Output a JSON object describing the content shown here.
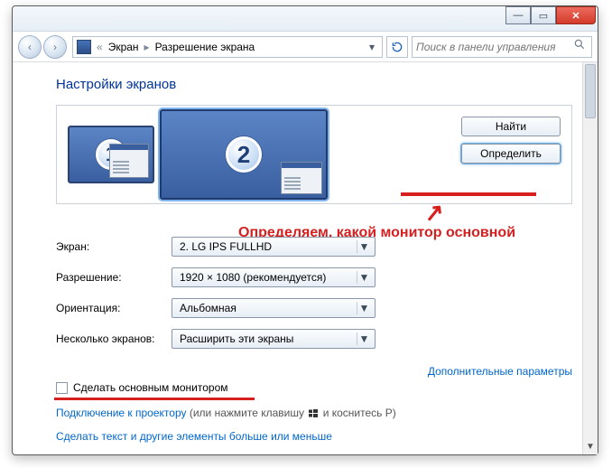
{
  "titlebar": {
    "min": "—",
    "max": "▭",
    "close": "✕"
  },
  "address": {
    "back": "‹",
    "fwd": "›",
    "crumb1": "Экран",
    "crumb2": "Разрешение экрана",
    "dropdown": "▾",
    "refresh": "↻"
  },
  "search": {
    "placeholder": "Поиск в панели управления",
    "icon": "🔍"
  },
  "page": {
    "heading": "Настройки экранов"
  },
  "monitors": {
    "num1": "1",
    "num2": "2",
    "find_label": "Найти",
    "identify_label": "Определить"
  },
  "annotation": {
    "text": "Определяем, какой монитор основной",
    "arrow": "↗"
  },
  "form": {
    "screen_label": "Экран:",
    "screen_value": "2. LG IPS FULLHD",
    "res_label": "Разрешение:",
    "res_value": "1920 × 1080 (рекомендуется)",
    "orient_label": "Ориентация:",
    "orient_value": "Альбомная",
    "multi_label": "Несколько экранов:",
    "multi_value": "Расширить эти экраны"
  },
  "checkbox": {
    "label": "Сделать основным монитором"
  },
  "links": {
    "advanced": "Дополнительные параметры",
    "projector": "Подключение к проектору",
    "projector_hint_a": " (или нажмите клавишу ",
    "projector_hint_b": " и коснитесь P)",
    "textsize": "Сделать текст и другие элементы больше или меньше"
  },
  "scrollbar": {
    "up": "▲",
    "down": "▼"
  }
}
